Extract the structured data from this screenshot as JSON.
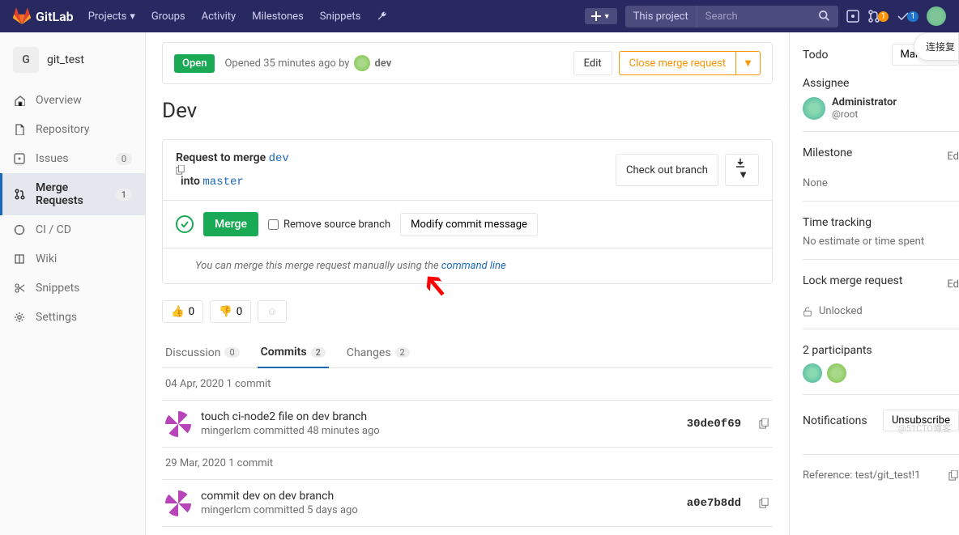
{
  "navbar": {
    "brand": "GitLab",
    "links": [
      "Projects",
      "Groups",
      "Activity",
      "Milestones",
      "Snippets"
    ],
    "search_scope": "This project",
    "search_placeholder": "Search",
    "mr_badge": "1",
    "todo_badge": "1"
  },
  "sidebar": {
    "project_letter": "G",
    "project_name": "git_test",
    "items": [
      {
        "label": "Overview",
        "icon": "home"
      },
      {
        "label": "Repository",
        "icon": "file"
      },
      {
        "label": "Issues",
        "icon": "issues",
        "badge": "0"
      },
      {
        "label": "Merge Requests",
        "icon": "merge",
        "badge": "1",
        "active": true
      },
      {
        "label": "CI / CD",
        "icon": "rocket"
      },
      {
        "label": "Wiki",
        "icon": "book"
      },
      {
        "label": "Snippets",
        "icon": "scissors"
      },
      {
        "label": "Settings",
        "icon": "gear"
      }
    ]
  },
  "mr": {
    "status": "Open",
    "opened_text": "Opened 35 minutes ago by",
    "author": "dev",
    "edit": "Edit",
    "close": "Close merge request",
    "title": "Dev",
    "request_prefix": "Request to merge",
    "source_branch": "dev",
    "into": "into",
    "target_branch": "master",
    "checkout": "Check out branch",
    "merge_label": "Merge",
    "remove_source": "Remove source branch",
    "modify_msg": "Modify commit message",
    "manual_text": "You can merge this merge request manually using the ",
    "manual_link": "command line",
    "thumbs_up": "0",
    "thumbs_down": "0"
  },
  "tabs": [
    {
      "label": "Discussion",
      "badge": "0"
    },
    {
      "label": "Commits",
      "badge": "2",
      "active": true
    },
    {
      "label": "Changes",
      "badge": "2"
    }
  ],
  "commits": {
    "groups": [
      {
        "header": "04 Apr, 2020 1 commit",
        "items": [
          {
            "title": "touch ci-node2 file on dev branch",
            "meta": "mingerlcm committed 48 minutes ago",
            "sha": "30de0f69"
          }
        ]
      },
      {
        "header": "29 Mar, 2020 1 commit",
        "items": [
          {
            "title": "commit dev on dev branch",
            "meta": "mingerlcm committed 5 days ago",
            "sha": "a0e7b8dd"
          }
        ]
      }
    ]
  },
  "right": {
    "todo": "Todo",
    "mark_done": "Mark done",
    "assignee_label": "Assignee",
    "assignee_name": "Administrator",
    "assignee_handle": "@root",
    "milestone_label": "Milestone",
    "milestone_value": "None",
    "edit": "Ed",
    "time_label": "Time tracking",
    "time_value": "No estimate or time spent",
    "lock_label": "Lock merge request",
    "lock_value": "Unlocked",
    "participants_label": "2 participants",
    "notifications_label": "Notifications",
    "unsubscribe": "Unsubscribe",
    "reference_label": "Reference: test/git_test!1"
  },
  "floating": "连接复",
  "watermark": "@51CTO博客"
}
